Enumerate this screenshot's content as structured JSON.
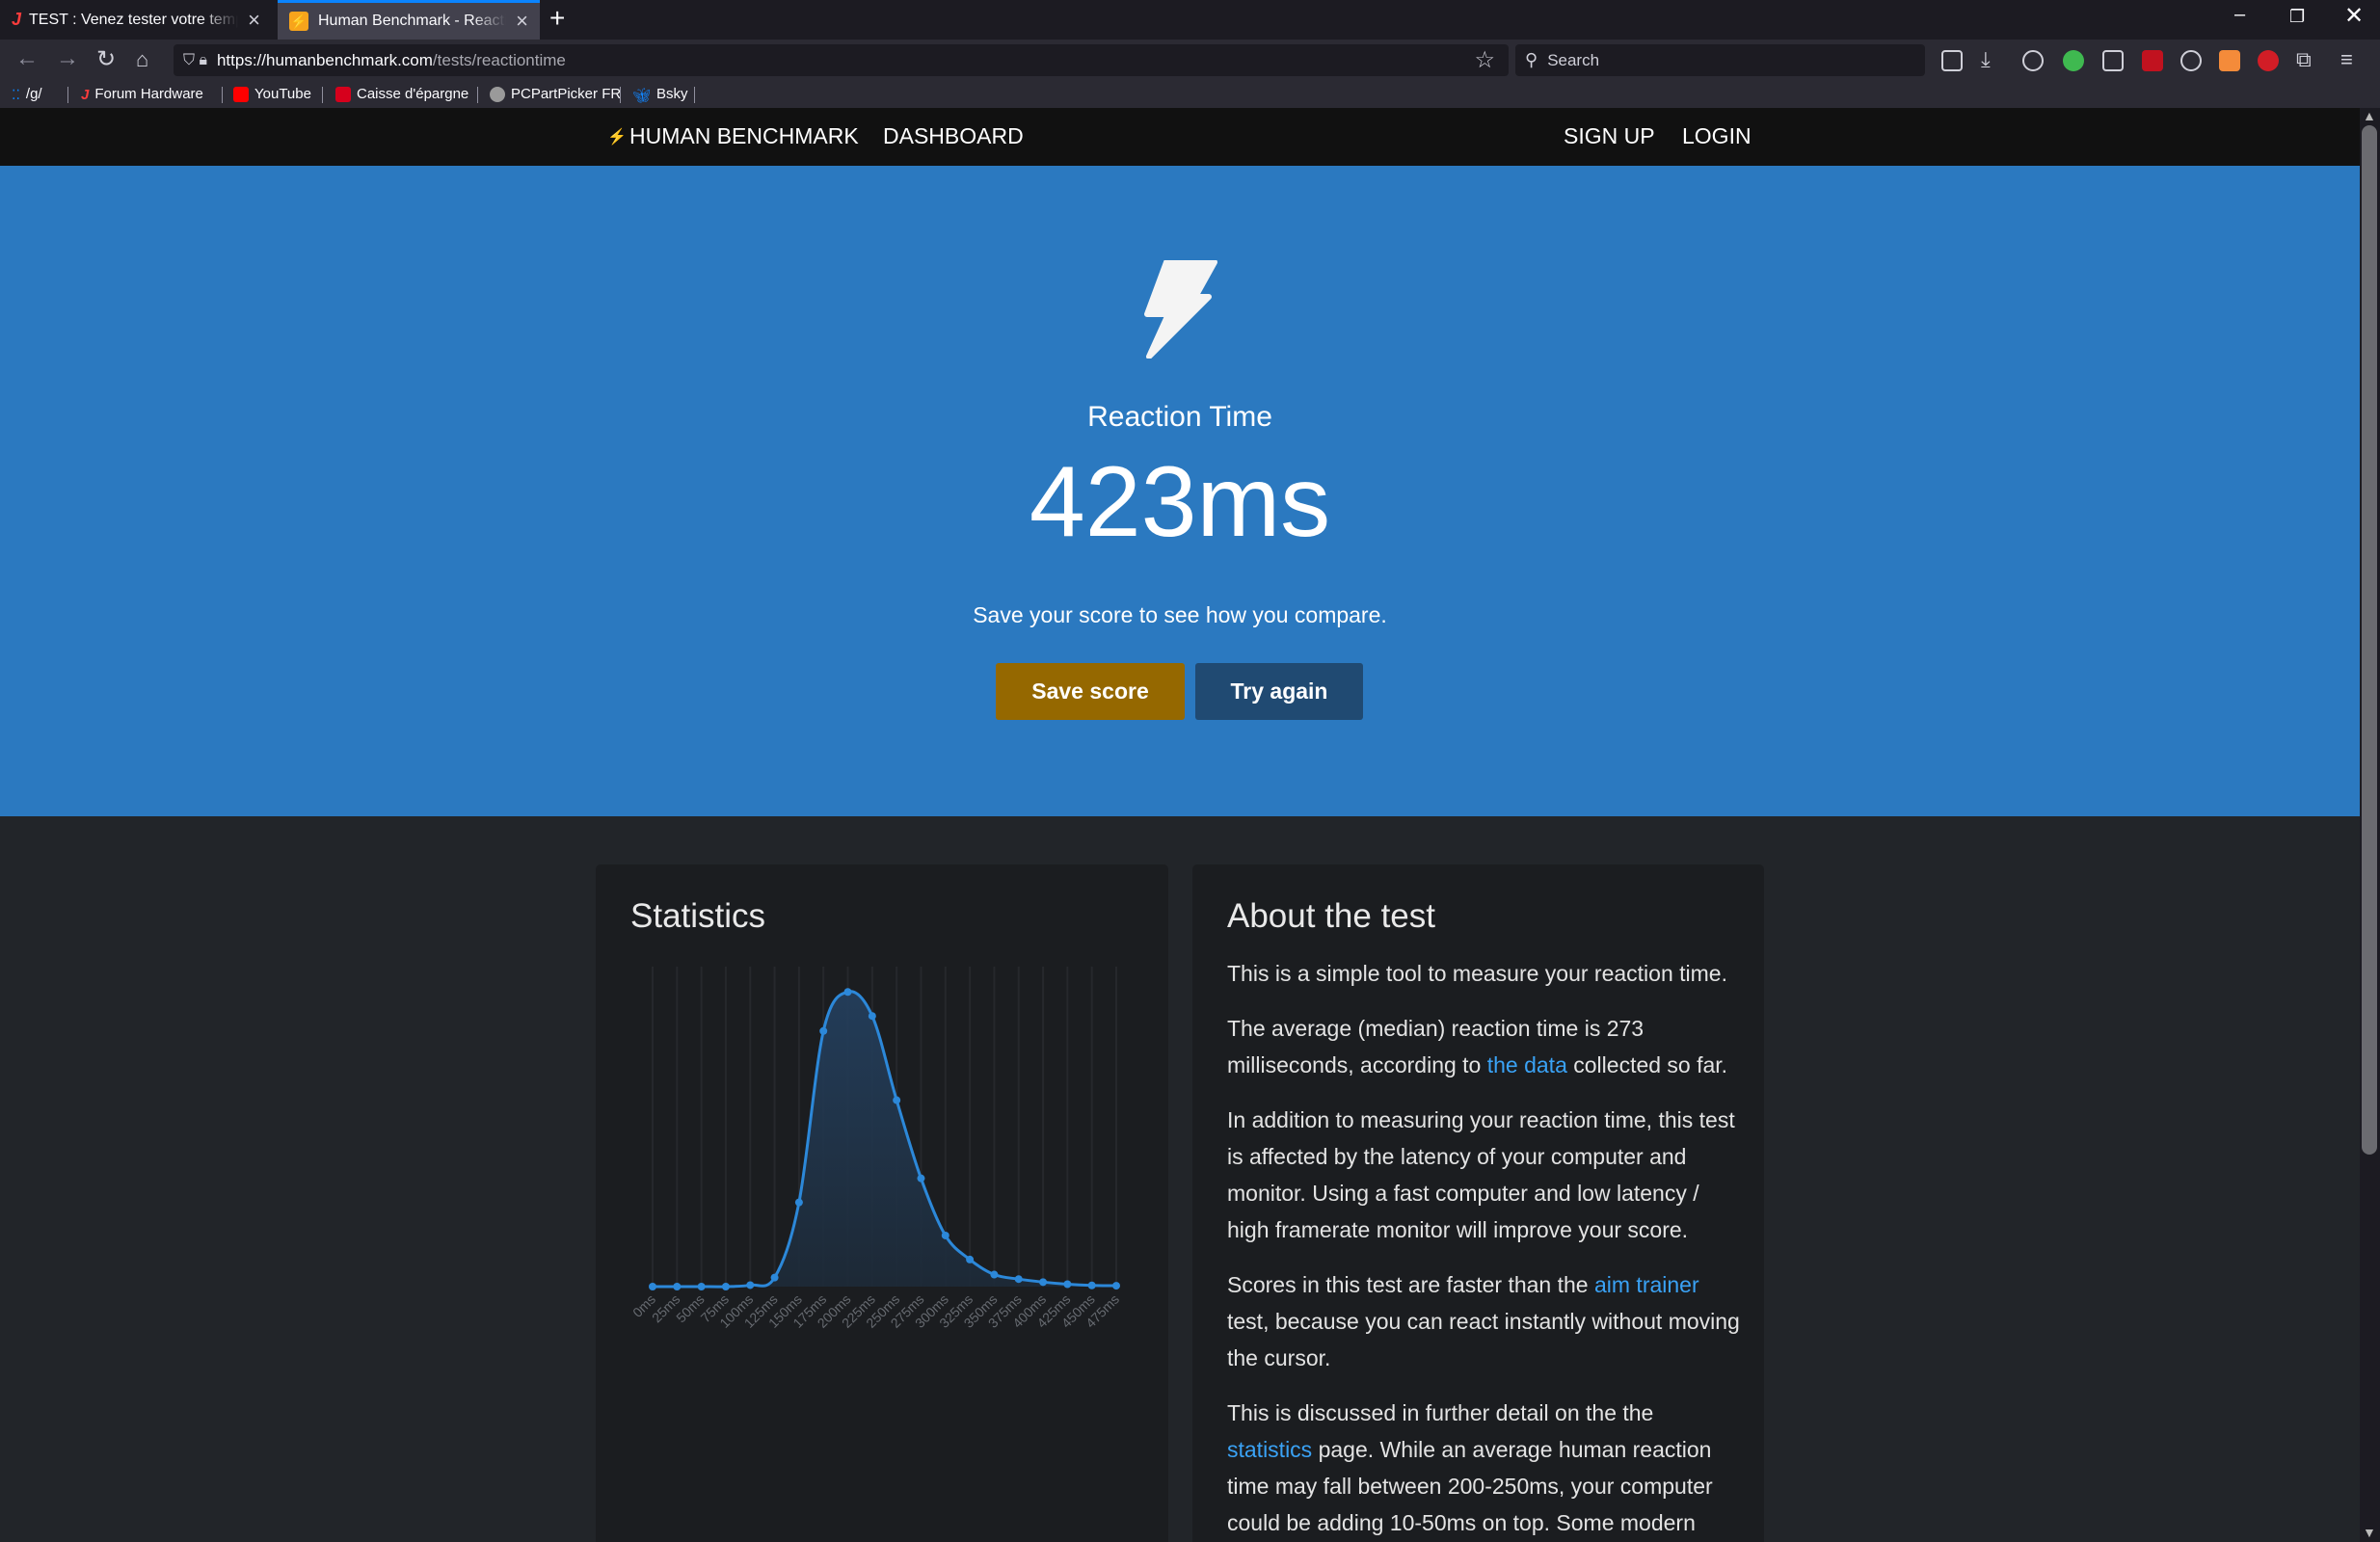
{
  "browser": {
    "tabs": [
      {
        "title": "TEST : Venez tester votre temps de réaction"
      },
      {
        "title": "Human Benchmark - Reaction Time Test"
      }
    ],
    "url": {
      "domain": "https://humanbenchmark.com",
      "path": "/tests/reactiontime"
    },
    "search_placeholder": "Search",
    "bookmarks": [
      "/g/",
      "Forum Hardware",
      "YouTube",
      "Caisse d'épargne",
      "PCPartPicker FR",
      "Bsky"
    ]
  },
  "site_nav": {
    "brand": "HUMAN BENCHMARK",
    "dashboard": "DASHBOARD",
    "signup": "SIGN UP",
    "login": "LOGIN"
  },
  "hero": {
    "test_name": "Reaction Time",
    "score": "423ms",
    "compare_text": "Save your score to see how you compare.",
    "save_label": "Save score",
    "try_again_label": "Try again"
  },
  "statistics": {
    "title": "Statistics"
  },
  "chart_data": {
    "type": "area",
    "title": "",
    "xlabel": "",
    "ylabel": "",
    "categories": [
      "0ms",
      "25ms",
      "50ms",
      "75ms",
      "100ms",
      "125ms",
      "150ms",
      "175ms",
      "200ms",
      "225ms",
      "250ms",
      "275ms",
      "300ms",
      "325ms",
      "350ms",
      "375ms",
      "400ms",
      "425ms",
      "450ms",
      "475ms"
    ],
    "values": [
      0,
      0,
      0,
      0,
      0.5,
      3,
      28,
      85,
      98,
      90,
      62,
      36,
      17,
      9,
      4,
      2.5,
      1.5,
      0.8,
      0.4,
      0.3
    ],
    "ylim": [
      0,
      100
    ],
    "grid": true,
    "line_color": "#2c88d9"
  },
  "about": {
    "title": "About the test",
    "p1": "This is a simple tool to measure your reaction time.",
    "p2_a": "The average (median) reaction time is 273 milliseconds, according to ",
    "p2_link": "the data",
    "p2_b": " collected so far.",
    "p3": "In addition to measuring your reaction time, this test is affected by the latency of your computer and monitor. Using a fast computer and low latency / high framerate monitor will improve your score.",
    "p4_a": "Scores in this test are faster than the ",
    "p4_link": "aim trainer",
    "p4_b": " test, because you can react instantly without moving the cursor.",
    "p5_a": "This is discussed in further detail on the the ",
    "p5_link": "statistics",
    "p5_b": " page. While an average human reaction time may fall between 200-250ms, your computer could be adding 10-50ms on top. Some modern"
  },
  "colors": {
    "hero_bg": "#2b79c0",
    "save_btn": "#956800",
    "try_btn": "#204a72",
    "link": "#3aa2f5"
  }
}
